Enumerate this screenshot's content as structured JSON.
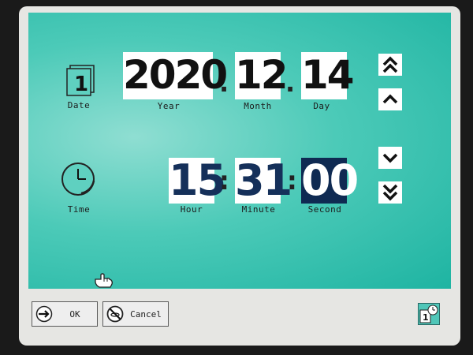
{
  "date": {
    "label": "Date",
    "year": {
      "value": "2020",
      "label": "Year"
    },
    "month": {
      "value": "12",
      "label": "Month"
    },
    "day": {
      "value": "14",
      "label": "Day"
    },
    "separator": "."
  },
  "time": {
    "label": "Time",
    "hour": {
      "value": "15",
      "label": "Hour"
    },
    "minute": {
      "value": "31",
      "label": "Minute"
    },
    "second": {
      "value": "00",
      "label": "Second"
    },
    "separator": ":"
  },
  "buttons": {
    "ok": "OK",
    "cancel": "Cancel"
  },
  "icons": {
    "date": "calendar-icon",
    "time": "clock-icon",
    "fast_up": "double-chevron-up-icon",
    "up": "chevron-up-icon",
    "down": "chevron-down-icon",
    "fast_down": "double-chevron-down-icon",
    "cursor": "hand-cursor-icon",
    "status": "date-time-settings-icon"
  },
  "colors": {
    "background": "#1eb4a2",
    "selected_field": "#0f2a52",
    "time_digits": "#15305a"
  }
}
